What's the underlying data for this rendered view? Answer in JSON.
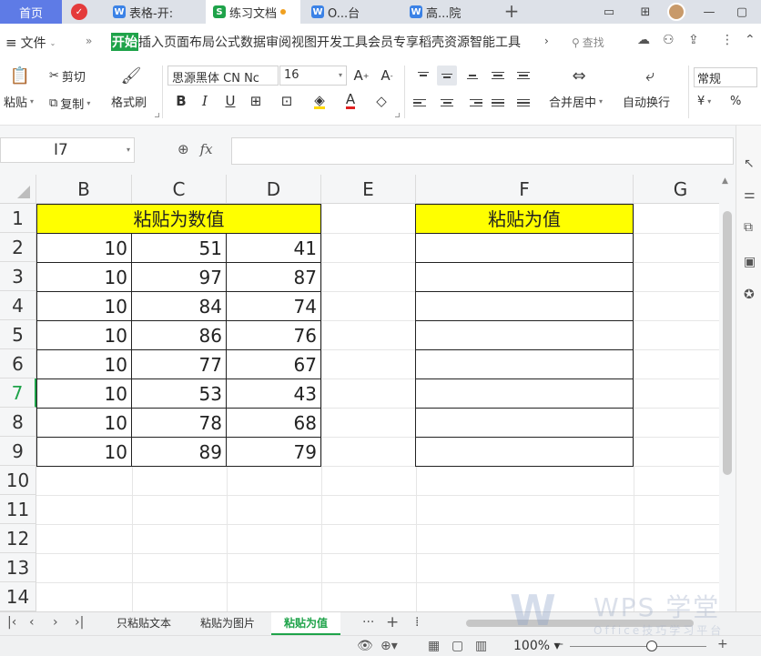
{
  "tabs": [
    {
      "label": "首页",
      "icon": ""
    },
    {
      "label": "",
      "icon": "wps-logo-icon",
      "color": "#e43b3b"
    },
    {
      "label": "表格-开:",
      "icon": "writer-icon",
      "color": "#3b82e6"
    },
    {
      "label": "练习文档",
      "icon": "sheet-icon",
      "color": "#1fa34a",
      "modified": true
    },
    {
      "label": "O...台",
      "icon": "office-icon",
      "color": "#3b82e6"
    },
    {
      "label": "高...院",
      "icon": "office-icon",
      "color": "#3b82e6"
    }
  ],
  "menu": {
    "file_label": "文件",
    "items": [
      "开始",
      "插入",
      "页面布局",
      "公式",
      "数据",
      "审阅",
      "视图",
      "开发工具",
      "会员专享",
      "稻壳资源",
      "智能工具"
    ],
    "active": "开始",
    "search_label": "查找"
  },
  "ribbon": {
    "paste": "粘贴",
    "cut": "剪切",
    "copy": "复制",
    "format_painter": "格式刷",
    "font_name": "思源黑体 CN Nc",
    "font_size": "16",
    "bold": "B",
    "italic": "I",
    "underline": "U",
    "font_color_letter": "A",
    "merge_center": "合并居中",
    "wrap_text": "自动换行",
    "number_format": "常规",
    "currency": "¥",
    "percent": "%"
  },
  "formula_bar": {
    "cell_ref": "I7",
    "fx": "fx",
    "content": ""
  },
  "columns": [
    "B",
    "C",
    "D",
    "E",
    "F",
    "G"
  ],
  "rows": [
    "1",
    "2",
    "3",
    "4",
    "5",
    "6",
    "7",
    "8",
    "9",
    "10",
    "11",
    "12",
    "13",
    "14"
  ],
  "selected_row": "7",
  "table_left": {
    "header": "粘贴为数值",
    "rows": [
      [
        "10",
        "51",
        "41"
      ],
      [
        "10",
        "97",
        "87"
      ],
      [
        "10",
        "84",
        "74"
      ],
      [
        "10",
        "86",
        "76"
      ],
      [
        "10",
        "77",
        "67"
      ],
      [
        "10",
        "53",
        "43"
      ],
      [
        "10",
        "78",
        "68"
      ],
      [
        "10",
        "89",
        "79"
      ]
    ]
  },
  "table_right": {
    "header": "粘贴为值",
    "rows": [
      "",
      "",
      "",
      "",
      "",
      "",
      "",
      ""
    ]
  },
  "sheet_tabs": [
    "只粘贴文本",
    "粘贴为图片",
    "粘贴为值"
  ],
  "active_sheet": "粘贴为值",
  "status": {
    "zoom": "100%"
  },
  "watermark": {
    "brand": "WPS 学堂",
    "sub": "Office技巧学习平台"
  },
  "colors": {
    "accent_green": "#1fa34a",
    "header_yellow": "#ffff00",
    "home_tab_blue": "#5e7be6"
  }
}
